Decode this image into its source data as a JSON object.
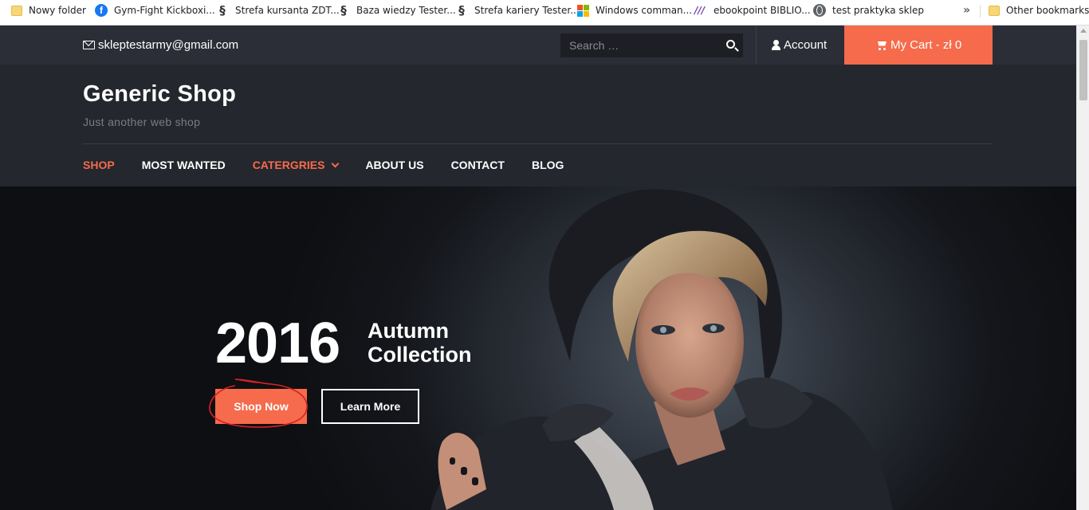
{
  "bookmarks": [
    {
      "label": "Nowy folder",
      "icon": "folder-icon"
    },
    {
      "label": "Gym-Fight Kickboxi...",
      "icon": "facebook-icon"
    },
    {
      "label": "Strefa kursanta ZDT...",
      "icon": "s-logo-icon"
    },
    {
      "label": "Baza wiedzy Tester...",
      "icon": "s-logo-icon"
    },
    {
      "label": "Strefa kariery Tester...",
      "icon": "s-logo-icon"
    },
    {
      "label": "Windows comman...",
      "icon": "windows-icon"
    },
    {
      "label": "ebookpoint BIBLIO...",
      "icon": "ebookpoint-icon"
    },
    {
      "label": "test praktyka sklep",
      "icon": "globe-icon"
    }
  ],
  "bookmarks_more": "»",
  "other_bookmarks": "Other bookmarks",
  "topbar": {
    "email": "skleptestarmy@gmail.com",
    "search_placeholder": "Search …",
    "account": "Account",
    "cart": "My Cart - zł 0"
  },
  "site": {
    "title": "Generic Shop",
    "tagline": "Just another web shop"
  },
  "nav": [
    {
      "label": "SHOP"
    },
    {
      "label": "MOST WANTED"
    },
    {
      "label": "CATERGRIES"
    },
    {
      "label": "ABOUT US"
    },
    {
      "label": "CONTACT"
    },
    {
      "label": "BLOG"
    }
  ],
  "hero": {
    "year": "2016",
    "title_line1": "Autumn",
    "title_line2": "Collection",
    "shop_button": "Shop Now",
    "learn_button": "Learn More"
  },
  "colors": {
    "accent": "#f56b4b",
    "header_bg": "#25272e",
    "topbar_bg": "#2b2e36"
  }
}
